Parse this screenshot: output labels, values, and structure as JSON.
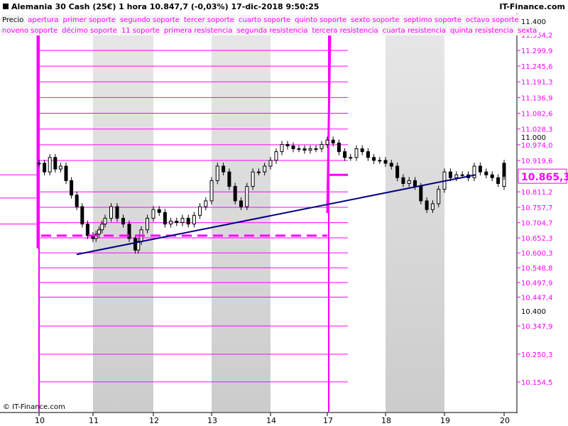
{
  "header": {
    "title": "Alemania 30 Cash (25€)   1 hora   10.847,7 (-0,03%)   17-dic-2018 9:50:25",
    "brand": "IT-Finance.com",
    "copyright": "© IT-Finance.com"
  },
  "legend": {
    "row1": [
      "Precio",
      "apertura",
      "primer soporte",
      "segundo soporte",
      "tercer soporte",
      "cuarto soporte",
      "quinto soporte",
      "sexto soporte",
      "septimo soporte",
      "octavo soporte"
    ],
    "row2": [
      "noveno soporte",
      "décimo soporte",
      "11 soporte",
      "primera resistencia",
      "segunda resistencia",
      "tercera resistencia",
      "cuarta resistencia",
      "quinta resistencia",
      "sexta"
    ]
  },
  "colors": {
    "level": "#ff00ff",
    "candle": "#000000",
    "trend": "#000080",
    "shade": "#d8d8d8"
  },
  "chart_data": {
    "type": "candlestick",
    "title": "Alemania 30 Cash (25€)",
    "xlabel": "",
    "ylabel": "",
    "x_ticks": [
      "10",
      "11",
      "12",
      "13",
      "14",
      "17",
      "18",
      "19",
      "20"
    ],
    "y_ticks_black": [
      "11.400",
      "11.000",
      "10.400"
    ],
    "ylim": [
      10120,
      11420
    ],
    "levels": [
      11354.2,
      11299.9,
      11245.6,
      11191.3,
      11136.9,
      11082.6,
      11028.3,
      10974.0,
      10919.6,
      10811.2,
      10757.7,
      10704.7,
      10652.3,
      10600.3,
      10548.8,
      10497.9,
      10447.4,
      10347.9,
      10250.3,
      10154.5
    ],
    "level_labels": [
      "11.354,2",
      "11.299,9",
      "11.245,6",
      "11.191,3",
      "11.136,9",
      "11.082,6",
      "11.028,3",
      "10.974,0",
      "10.919,6",
      "10.811,2",
      "10.757,7",
      "10.704,7",
      "10.652,3",
      "10.600,3",
      "10.548,8",
      "10.497,9",
      "10.447,4",
      "10.347,9",
      "10.250,3",
      "10.154,5"
    ],
    "last_price": 10865.3,
    "last_price_label": "10.865,3",
    "apertura_old": 10660,
    "apertura_new": 10870,
    "trendline": {
      "start": [
        10.6,
        10595
      ],
      "end": [
        19.55,
        10870
      ]
    },
    "closes": [
      [
        10.0,
        10910
      ],
      [
        10.1,
        10880
      ],
      [
        10.2,
        10930
      ],
      [
        10.3,
        10890
      ],
      [
        10.4,
        10900
      ],
      [
        10.5,
        10850
      ],
      [
        10.6,
        10800
      ],
      [
        10.7,
        10760
      ],
      [
        10.8,
        10700
      ],
      [
        10.9,
        10660
      ],
      [
        11.0,
        10650
      ],
      [
        11.05,
        10665
      ],
      [
        11.1,
        10680
      ],
      [
        11.15,
        10700
      ],
      [
        11.2,
        10720
      ],
      [
        11.3,
        10760
      ],
      [
        11.4,
        10720
      ],
      [
        11.5,
        10700
      ],
      [
        11.6,
        10650
      ],
      [
        11.7,
        10610
      ],
      [
        11.75,
        10640
      ],
      [
        11.8,
        10680
      ],
      [
        11.9,
        10720
      ],
      [
        12.0,
        10750
      ],
      [
        12.1,
        10740
      ],
      [
        12.2,
        10700
      ],
      [
        12.3,
        10710
      ],
      [
        12.4,
        10705
      ],
      [
        12.5,
        10720
      ],
      [
        12.6,
        10700
      ],
      [
        12.7,
        10730
      ],
      [
        12.8,
        10760
      ],
      [
        12.9,
        10780
      ],
      [
        13.0,
        10850
      ],
      [
        13.1,
        10900
      ],
      [
        13.2,
        10880
      ],
      [
        13.3,
        10830
      ],
      [
        13.4,
        10780
      ],
      [
        13.5,
        10760
      ],
      [
        13.6,
        10830
      ],
      [
        13.7,
        10880
      ],
      [
        13.8,
        10880
      ],
      [
        13.9,
        10900
      ],
      [
        14.0,
        10920
      ],
      [
        14.1,
        10950
      ],
      [
        14.2,
        10975
      ],
      [
        14.3,
        10970
      ],
      [
        14.4,
        10960
      ],
      [
        14.5,
        10960
      ],
      [
        14.6,
        10955
      ],
      [
        14.7,
        10960
      ],
      [
        14.8,
        10960
      ],
      [
        14.9,
        10975
      ],
      [
        15.0,
        10990
      ],
      [
        15.1,
        10980
      ],
      [
        15.2,
        10950
      ],
      [
        15.3,
        10930
      ],
      [
        15.4,
        10930
      ],
      [
        15.5,
        10960
      ],
      [
        15.6,
        10950
      ],
      [
        15.7,
        10930
      ],
      [
        15.8,
        10920
      ],
      [
        15.9,
        10920
      ],
      [
        16.0,
        10910
      ],
      [
        16.1,
        10900
      ],
      [
        16.2,
        10860
      ],
      [
        16.3,
        10840
      ],
      [
        16.4,
        10850
      ],
      [
        16.5,
        10830
      ],
      [
        16.6,
        10780
      ],
      [
        16.7,
        10750
      ],
      [
        16.8,
        10770
      ],
      [
        16.9,
        10820
      ],
      [
        17.0,
        10880
      ],
      [
        17.1,
        10860
      ],
      [
        17.2,
        10870
      ],
      [
        17.3,
        10870
      ],
      [
        17.4,
        10860
      ],
      [
        17.5,
        10900
      ],
      [
        17.6,
        10880
      ],
      [
        17.7,
        10870
      ],
      [
        17.8,
        10860
      ],
      [
        17.9,
        10840
      ],
      [
        18.0,
        10830
      ],
      [
        18.1,
        10880
      ],
      [
        18.2,
        10900
      ],
      [
        18.25,
        10910
      ],
      [
        18.3,
        10880
      ],
      [
        18.35,
        10865
      ]
    ]
  }
}
